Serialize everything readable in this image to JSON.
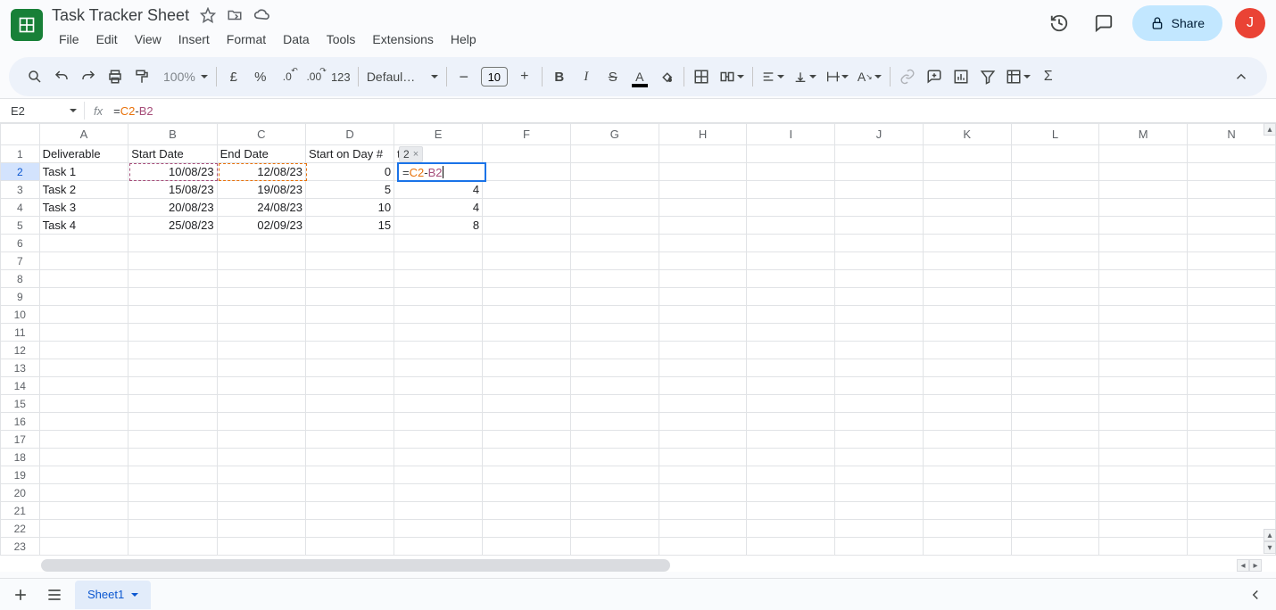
{
  "header": {
    "title": "Task Tracker Sheet",
    "avatar_initial": "J",
    "share": "Share",
    "menu": [
      "File",
      "Edit",
      "View",
      "Insert",
      "Format",
      "Data",
      "Tools",
      "Extensions",
      "Help"
    ]
  },
  "toolbar": {
    "zoom": "100%",
    "currency": "£",
    "percent": "%",
    "dec_dec": ".0",
    "inc_dec": ".00",
    "numfmt": "123",
    "font": "Defaul…",
    "font_size": "10",
    "minus": "−",
    "plus": "+",
    "bold": "B",
    "italic": "I",
    "strike": "S",
    "textcolor_letter": "A",
    "sigma": "Σ"
  },
  "fbar": {
    "cell": "E2",
    "fx": "fx",
    "eq": "=",
    "ref1": "C2",
    "op": "-",
    "ref2": "B2"
  },
  "columns": [
    "A",
    "B",
    "C",
    "D",
    "E",
    "F",
    "G",
    "H",
    "I",
    "J",
    "K",
    "L",
    "M",
    "N"
  ],
  "row_numbers": [
    "1",
    "2",
    "3",
    "4",
    "5",
    "6",
    "7",
    "8",
    "9",
    "10",
    "11",
    "12",
    "13",
    "14",
    "15",
    "16",
    "17",
    "18",
    "19",
    "20",
    "21",
    "22",
    "23"
  ],
  "headers": {
    "A": "Deliverable",
    "B": "Start Date",
    "C": "End Date",
    "D": "Start on Day #",
    "E": "tion"
  },
  "rows": [
    {
      "A": "Task 1",
      "B": "10/08/23",
      "C": "12/08/23",
      "D": "0",
      "E": ""
    },
    {
      "A": "Task 2",
      "B": "15/08/23",
      "C": "19/08/23",
      "D": "5",
      "E": "4"
    },
    {
      "A": "Task 3",
      "B": "20/08/23",
      "C": "24/08/23",
      "D": "10",
      "E": "4"
    },
    {
      "A": "Task 4",
      "B": "25/08/23",
      "C": "02/09/23",
      "D": "15",
      "E": "8"
    }
  ],
  "edit": {
    "hint": "2",
    "hint_close": "×",
    "eq": "=",
    "ref1": "C2",
    "op": "-",
    "ref2": "B2"
  },
  "sheetbar": {
    "tab": "Sheet1"
  }
}
